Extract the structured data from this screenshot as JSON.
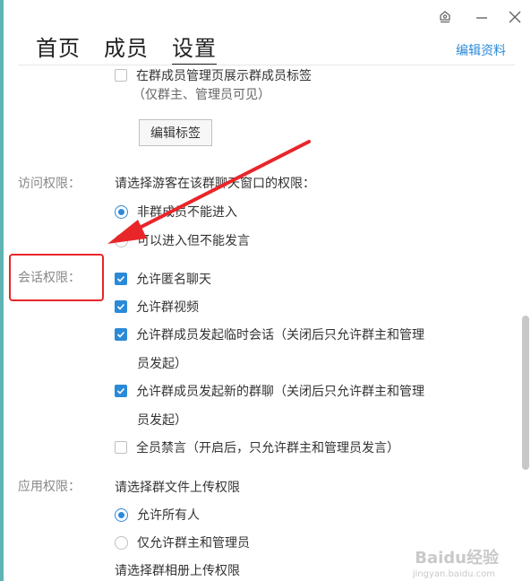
{
  "header": {
    "tabs": [
      {
        "label": "首页"
      },
      {
        "label": "成员"
      },
      {
        "label": "设置",
        "active": true
      }
    ],
    "edit_profile": "编辑资料"
  },
  "member_tags": {
    "show_tags_label": "在群成员管理页展示群成员标签",
    "show_tags_checked": false,
    "hint": "（仅群主、管理员可见）",
    "edit_tags_button": "编辑标签"
  },
  "access": {
    "label": "访问权限：",
    "prompt": "请选择游客在该群聊天窗口的权限：",
    "options": [
      {
        "label": "非群成员不能进入",
        "selected": true
      },
      {
        "label": "可以进入但不能发言",
        "selected": false
      }
    ]
  },
  "session": {
    "label": "会话权限：",
    "options": [
      {
        "label": "允许匿名聊天",
        "checked": true
      },
      {
        "label": "允许群视频",
        "checked": true
      },
      {
        "label": "允许群成员发起临时会话（关闭后只允许群主和管理",
        "label_cont": "员发起）",
        "checked": true
      },
      {
        "label": "允许群成员发起新的群聊（关闭后只允许群主和管理",
        "label_cont": "员发起）",
        "checked": true
      },
      {
        "label": "全员禁言（开启后，只允许群主和管理员发言）",
        "checked": false
      }
    ]
  },
  "app": {
    "label": "应用权限：",
    "upload_prompt": "请选择群文件上传权限",
    "upload_options": [
      {
        "label": "允许所有人",
        "selected": true
      },
      {
        "label": "仅允许群主和管理员",
        "selected": false
      }
    ],
    "album_prompt": "请选择群相册上传权限"
  },
  "watermark": {
    "text": "Baidu经验",
    "sub": "jingyan.baidu.com"
  },
  "colors": {
    "accent": "#2b8ad8",
    "annotation": "#e8262a"
  }
}
